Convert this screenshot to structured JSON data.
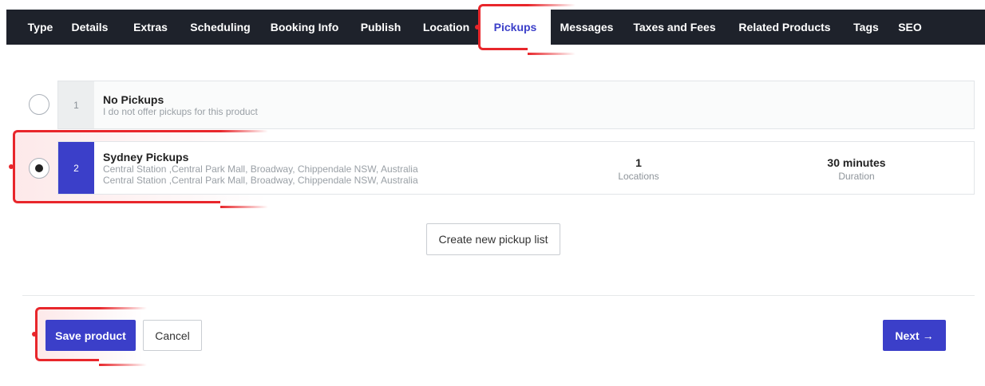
{
  "tabs": [
    {
      "label": "Type"
    },
    {
      "label": "Details"
    },
    {
      "label": "Extras"
    },
    {
      "label": "Scheduling"
    },
    {
      "label": "Booking Info"
    },
    {
      "label": "Publish"
    },
    {
      "label": "Location"
    },
    {
      "label": "Pickups",
      "active": true
    },
    {
      "label": "Messages"
    },
    {
      "label": "Taxes and Fees"
    },
    {
      "label": "Related Products"
    },
    {
      "label": "Tags"
    },
    {
      "label": "SEO"
    }
  ],
  "pickups": [
    {
      "number": "1",
      "title": "No Pickups",
      "line1": "I do not offer pickups for this product",
      "selected": false
    },
    {
      "number": "2",
      "title": "Sydney Pickups",
      "line1": "Central Station ,Central Park Mall, Broadway, Chippendale NSW, Australia",
      "line2": "Central Station ,Central Park Mall, Broadway, Chippendale NSW, Australia",
      "locations_value": "1",
      "locations_label": "Locations",
      "duration_value": "30 minutes",
      "duration_label": "Duration",
      "selected": true
    }
  ],
  "create_button": "Create new pickup list",
  "footer": {
    "save": "Save product",
    "cancel": "Cancel",
    "next": "Next →"
  },
  "colors": {
    "nav_bg": "#1e222b",
    "accent": "#3b3fc9",
    "highlight": "#e8262b"
  }
}
